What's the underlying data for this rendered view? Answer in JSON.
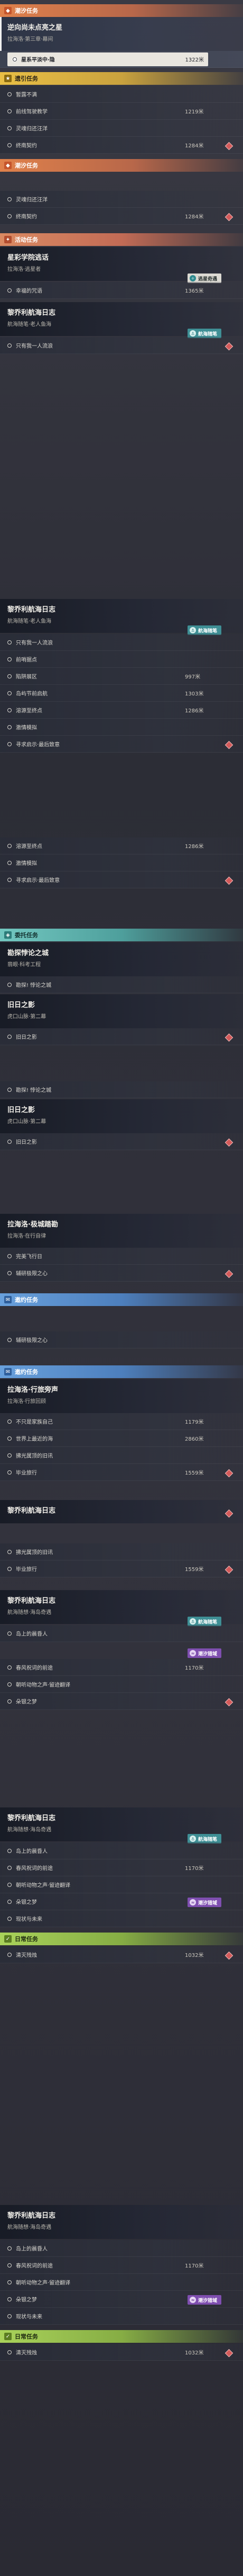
{
  "headers": {
    "story": "潮汐任务",
    "daily": "遗引任务",
    "event": "活动任务",
    "side": "委托任务",
    "invite": "邀约任务",
    "guide": "日常任务"
  },
  "cards": {
    "c1": {
      "title": "逆向尚未点亮之星",
      "sub": "拉海洛·第三章·幕间"
    },
    "c2": {
      "title": "星彩学院逃话",
      "sub": "拉海洛·逃星者"
    },
    "c3": {
      "title": "黎乔利航海日志",
      "sub": "航海随笔·老人鱼海"
    },
    "c4": {
      "title": "黎乔利航海日志",
      "sub": "航海随笔·老人鱼海"
    },
    "c5": {
      "title": "勘探悖论之城",
      "sub": "翡眼·科考工程"
    },
    "c6": {
      "title": "旧日之影",
      "sub": "虎口山脉·第二幕"
    },
    "c7": {
      "title": "旧日之影",
      "sub": "虎口山脉·第二幕"
    },
    "c8": {
      "title": "拉海洛·极城踏勘",
      "sub": "拉海洛·在行自律"
    },
    "c9": {
      "title": "拉海洛·行旅旁声",
      "sub": "拉海洛·行旅回顾"
    },
    "c10": {
      "title": "黎乔利航海日志",
      "sub": ""
    },
    "c11": {
      "title": "黎乔利航海日志",
      "sub": "航海随想·海岛奇遇"
    },
    "c12": {
      "title": "黎乔利航海日志",
      "sub": "航海随想·海岛奇遇"
    },
    "c13": {
      "title": "黎乔利航海日志",
      "sub": "航海随想·海岛奇遇"
    }
  },
  "steps": {
    "s1": "星系平淡中·隐",
    "s1d": "1322米",
    "s2": "暂露不满",
    "s3": "前线驾驶教学",
    "s3d": "1219米",
    "s4": "灵魂归还汪洋",
    "s5": "终南契约",
    "s5d": "1284米",
    "s6": "灵魂归还汪洋",
    "s7": "终南契约",
    "s7d": "1284米",
    "s8": "幸福的咒语",
    "s8d": "1365米",
    "s9": "只有我一人流浪",
    "s10": "只有我一人流浪",
    "s11": "前哨据点",
    "s12": "陷阱展区",
    "s12d": "997米",
    "s13": "岛屿节前启航",
    "s13d": "1303米",
    "s14": "溶源至终点",
    "s14d": "1286米",
    "s15": "激情模拟",
    "s16": "寻求启示·最后致意",
    "s17": "溶源至终点",
    "s17d": "1286米",
    "s18": "激情模拟",
    "s19": "寻求启示·最后致意",
    "s20": "勘探! 悖论之城",
    "s21": "勘探! 悖论之城",
    "s22": "旧日之影",
    "s23": "旧日之影",
    "s24": "完美飞行日",
    "s25": "辅研极限之心",
    "s26": "辅研极限之心",
    "s27": "不只是家族自己",
    "s27d": "1179米",
    "s28": "世界上最近的海",
    "s28d": "2860米",
    "s29": "拂光属顶的旧讯",
    "s30": "毕业旅行",
    "s30d": "1559米",
    "s31": "拂光属顶的旧讯",
    "s32": "毕业旅行",
    "s32d": "1559米",
    "s33": "岛上的晨昏人",
    "s34": "春风祝词的前途",
    "s34d": "1170米",
    "s35": "朝听动物之声·留迹翻译",
    "s36": "朵银之梦",
    "s37": "岛上的晨昏人",
    "s38": "春风祝词的前途",
    "s38d": "1170米",
    "s39": "朝听动物之声·留迹翻译",
    "s40": "朵银之梦",
    "s41": "现状与未来",
    "s42": "清灭残烛",
    "s42d": "1032米",
    "s43": "岛上的晨昏人",
    "s44": "春风祝词的前途",
    "s44d": "1170米",
    "s45": "朝听动物之声·留迹翻译",
    "s46": "朵银之梦",
    "s47": "现状与未来",
    "s48": "清灭残烛",
    "s48d": "1032米"
  },
  "tags": {
    "nav": "航海随笔",
    "star": "逃星奇遇",
    "purple": "潮汐猎域"
  },
  "colors": {
    "story": "#e0814b",
    "daily": "#e9bf45",
    "event": "#db8a62",
    "side": "#72c7c0",
    "invite": "#68a0dc",
    "guide": "#a9d25a",
    "marker": "#d45a5a"
  }
}
